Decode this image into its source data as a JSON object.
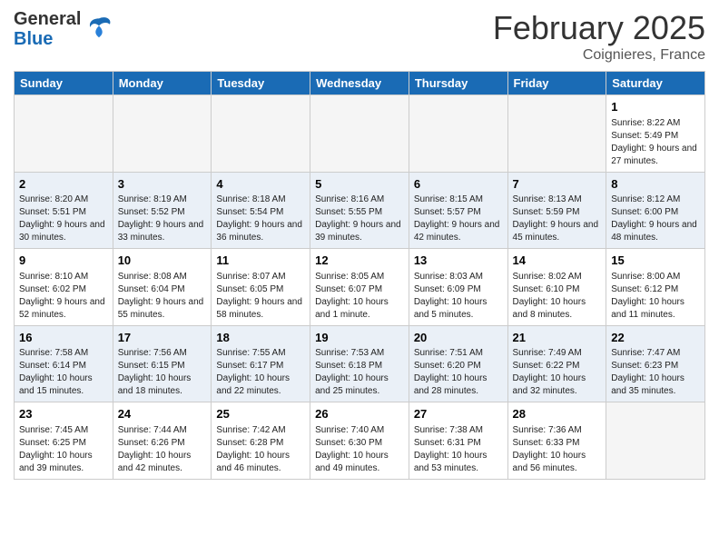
{
  "header": {
    "logo_general": "General",
    "logo_blue": "Blue",
    "month_title": "February 2025",
    "location": "Coignieres, France"
  },
  "days_of_week": [
    "Sunday",
    "Monday",
    "Tuesday",
    "Wednesday",
    "Thursday",
    "Friday",
    "Saturday"
  ],
  "weeks": [
    {
      "alt": false,
      "days": [
        {
          "num": "",
          "info": "",
          "empty": true
        },
        {
          "num": "",
          "info": "",
          "empty": true
        },
        {
          "num": "",
          "info": "",
          "empty": true
        },
        {
          "num": "",
          "info": "",
          "empty": true
        },
        {
          "num": "",
          "info": "",
          "empty": true
        },
        {
          "num": "",
          "info": "",
          "empty": true
        },
        {
          "num": "1",
          "info": "Sunrise: 8:22 AM\nSunset: 5:49 PM\nDaylight: 9 hours and 27 minutes.",
          "empty": false
        }
      ]
    },
    {
      "alt": true,
      "days": [
        {
          "num": "2",
          "info": "Sunrise: 8:20 AM\nSunset: 5:51 PM\nDaylight: 9 hours and 30 minutes.",
          "empty": false
        },
        {
          "num": "3",
          "info": "Sunrise: 8:19 AM\nSunset: 5:52 PM\nDaylight: 9 hours and 33 minutes.",
          "empty": false
        },
        {
          "num": "4",
          "info": "Sunrise: 8:18 AM\nSunset: 5:54 PM\nDaylight: 9 hours and 36 minutes.",
          "empty": false
        },
        {
          "num": "5",
          "info": "Sunrise: 8:16 AM\nSunset: 5:55 PM\nDaylight: 9 hours and 39 minutes.",
          "empty": false
        },
        {
          "num": "6",
          "info": "Sunrise: 8:15 AM\nSunset: 5:57 PM\nDaylight: 9 hours and 42 minutes.",
          "empty": false
        },
        {
          "num": "7",
          "info": "Sunrise: 8:13 AM\nSunset: 5:59 PM\nDaylight: 9 hours and 45 minutes.",
          "empty": false
        },
        {
          "num": "8",
          "info": "Sunrise: 8:12 AM\nSunset: 6:00 PM\nDaylight: 9 hours and 48 minutes.",
          "empty": false
        }
      ]
    },
    {
      "alt": false,
      "days": [
        {
          "num": "9",
          "info": "Sunrise: 8:10 AM\nSunset: 6:02 PM\nDaylight: 9 hours and 52 minutes.",
          "empty": false
        },
        {
          "num": "10",
          "info": "Sunrise: 8:08 AM\nSunset: 6:04 PM\nDaylight: 9 hours and 55 minutes.",
          "empty": false
        },
        {
          "num": "11",
          "info": "Sunrise: 8:07 AM\nSunset: 6:05 PM\nDaylight: 9 hours and 58 minutes.",
          "empty": false
        },
        {
          "num": "12",
          "info": "Sunrise: 8:05 AM\nSunset: 6:07 PM\nDaylight: 10 hours and 1 minute.",
          "empty": false
        },
        {
          "num": "13",
          "info": "Sunrise: 8:03 AM\nSunset: 6:09 PM\nDaylight: 10 hours and 5 minutes.",
          "empty": false
        },
        {
          "num": "14",
          "info": "Sunrise: 8:02 AM\nSunset: 6:10 PM\nDaylight: 10 hours and 8 minutes.",
          "empty": false
        },
        {
          "num": "15",
          "info": "Sunrise: 8:00 AM\nSunset: 6:12 PM\nDaylight: 10 hours and 11 minutes.",
          "empty": false
        }
      ]
    },
    {
      "alt": true,
      "days": [
        {
          "num": "16",
          "info": "Sunrise: 7:58 AM\nSunset: 6:14 PM\nDaylight: 10 hours and 15 minutes.",
          "empty": false
        },
        {
          "num": "17",
          "info": "Sunrise: 7:56 AM\nSunset: 6:15 PM\nDaylight: 10 hours and 18 minutes.",
          "empty": false
        },
        {
          "num": "18",
          "info": "Sunrise: 7:55 AM\nSunset: 6:17 PM\nDaylight: 10 hours and 22 minutes.",
          "empty": false
        },
        {
          "num": "19",
          "info": "Sunrise: 7:53 AM\nSunset: 6:18 PM\nDaylight: 10 hours and 25 minutes.",
          "empty": false
        },
        {
          "num": "20",
          "info": "Sunrise: 7:51 AM\nSunset: 6:20 PM\nDaylight: 10 hours and 28 minutes.",
          "empty": false
        },
        {
          "num": "21",
          "info": "Sunrise: 7:49 AM\nSunset: 6:22 PM\nDaylight: 10 hours and 32 minutes.",
          "empty": false
        },
        {
          "num": "22",
          "info": "Sunrise: 7:47 AM\nSunset: 6:23 PM\nDaylight: 10 hours and 35 minutes.",
          "empty": false
        }
      ]
    },
    {
      "alt": false,
      "days": [
        {
          "num": "23",
          "info": "Sunrise: 7:45 AM\nSunset: 6:25 PM\nDaylight: 10 hours and 39 minutes.",
          "empty": false
        },
        {
          "num": "24",
          "info": "Sunrise: 7:44 AM\nSunset: 6:26 PM\nDaylight: 10 hours and 42 minutes.",
          "empty": false
        },
        {
          "num": "25",
          "info": "Sunrise: 7:42 AM\nSunset: 6:28 PM\nDaylight: 10 hours and 46 minutes.",
          "empty": false
        },
        {
          "num": "26",
          "info": "Sunrise: 7:40 AM\nSunset: 6:30 PM\nDaylight: 10 hours and 49 minutes.",
          "empty": false
        },
        {
          "num": "27",
          "info": "Sunrise: 7:38 AM\nSunset: 6:31 PM\nDaylight: 10 hours and 53 minutes.",
          "empty": false
        },
        {
          "num": "28",
          "info": "Sunrise: 7:36 AM\nSunset: 6:33 PM\nDaylight: 10 hours and 56 minutes.",
          "empty": false
        },
        {
          "num": "",
          "info": "",
          "empty": true
        }
      ]
    }
  ]
}
